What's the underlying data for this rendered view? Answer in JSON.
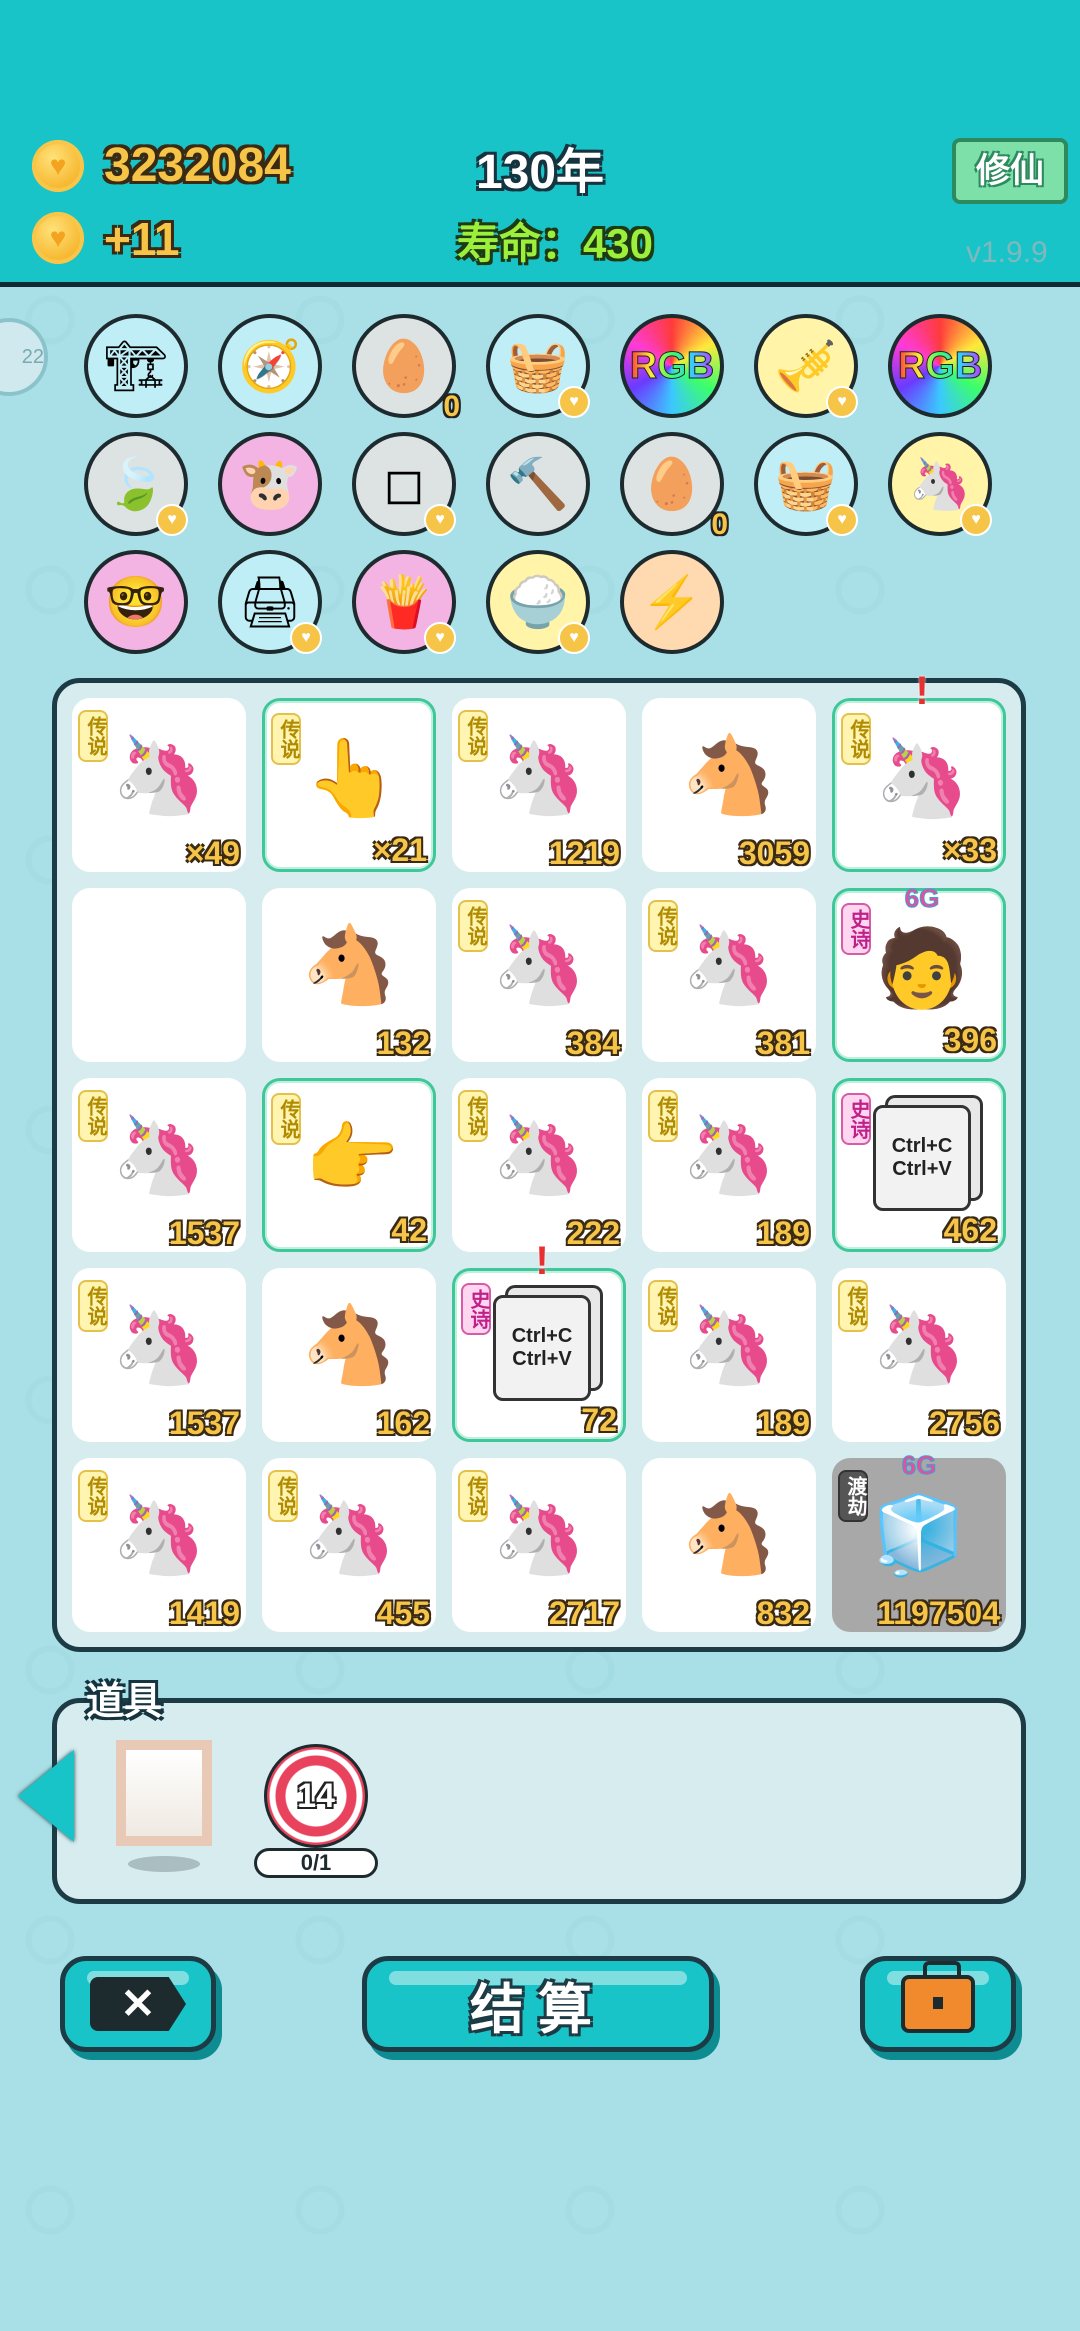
{
  "header": {
    "coins": "3232084",
    "income": "+11",
    "year": "130年",
    "lifespan": "寿命：430",
    "cultivate_button": "修仙",
    "version": "v1.9.9"
  },
  "side_badge": "22",
  "items": [
    {
      "icon": "🏗",
      "bg": "#bfeef7",
      "name": "pump-icon",
      "badge": false,
      "count": ""
    },
    {
      "icon": "🧭",
      "bg": "#bfeef7",
      "name": "compass-icon",
      "badge": false,
      "count": ""
    },
    {
      "icon": "🥚",
      "bg": "#dde3e3",
      "name": "egg-tray-icon",
      "badge": false,
      "count": "0"
    },
    {
      "icon": "🧺",
      "bg": "#bfeef7",
      "name": "fruit-basket-icon",
      "badge": true,
      "count": ""
    },
    {
      "icon": "RGB",
      "bg": "rainbow",
      "name": "rgb-icon",
      "badge": false,
      "count": ""
    },
    {
      "icon": "🎺",
      "bg": "#fff4a8",
      "name": "horn-icon",
      "badge": true,
      "count": ""
    },
    {
      "icon": "RGB",
      "bg": "rainbow",
      "name": "rgb-icon",
      "badge": false,
      "count": ""
    },
    {
      "icon": "🍃",
      "bg": "#dde3e3",
      "name": "leaf-icon",
      "badge": true,
      "count": ""
    },
    {
      "icon": "🐮",
      "bg": "#f3b3e3",
      "name": "cow-icon",
      "badge": false,
      "count": ""
    },
    {
      "icon": "◻",
      "bg": "#dde3e3",
      "name": "sugar-cube-icon",
      "badge": true,
      "count": ""
    },
    {
      "icon": "🔨",
      "bg": "#dde3e3",
      "name": "hammer-icon",
      "badge": false,
      "count": ""
    },
    {
      "icon": "🥚",
      "bg": "#dde3e3",
      "name": "egg-tray-icon",
      "badge": false,
      "count": "0"
    },
    {
      "icon": "🧺",
      "bg": "#bfeef7",
      "name": "fruit-basket-icon",
      "badge": true,
      "count": ""
    },
    {
      "icon": "🦄",
      "bg": "#fff4a8",
      "name": "unicorn-icon",
      "badge": true,
      "count": ""
    },
    {
      "icon": "🤓",
      "bg": "#f3b3e3",
      "name": "math-nerd-icon",
      "badge": false,
      "count": ""
    },
    {
      "icon": "🖨",
      "bg": "#bfeef7",
      "name": "printer-icon",
      "badge": true,
      "count": ""
    },
    {
      "icon": "🍟",
      "bg": "#f3b3e3",
      "name": "fries-icon",
      "badge": true,
      "count": ""
    },
    {
      "icon": "🍚",
      "bg": "#fff4a8",
      "name": "rice-bowl-icon",
      "badge": true,
      "count": ""
    },
    {
      "icon": "⚡",
      "bg": "#ffd9b0",
      "name": "lightning-icon",
      "badge": false,
      "count": ""
    }
  ],
  "board": [
    {
      "icon": "🦄",
      "tag": "传说",
      "tag_type": "legend",
      "num": "×49",
      "hl": false,
      "top": "",
      "excl": false
    },
    {
      "icon": "👆",
      "tag": "传说",
      "tag_type": "legend",
      "num": "×21",
      "hl": true,
      "top": "",
      "excl": false
    },
    {
      "icon": "🦄",
      "tag": "传说",
      "tag_type": "legend",
      "num": "1219",
      "hl": false,
      "top": "",
      "excl": false
    },
    {
      "icon": "🐴",
      "tag": "",
      "tag_type": "",
      "num": "3059",
      "hl": false,
      "top": "",
      "excl": false
    },
    {
      "icon": "🦄",
      "tag": "传说",
      "tag_type": "legend",
      "num": "×33",
      "hl": true,
      "top": "",
      "excl": true
    },
    {
      "icon": "",
      "tag": "",
      "tag_type": "",
      "num": "",
      "hl": false,
      "top": "",
      "excl": false
    },
    {
      "icon": "🐴",
      "tag": "",
      "tag_type": "",
      "num": "132",
      "hl": false,
      "top": "",
      "excl": false
    },
    {
      "icon": "🦄",
      "tag": "传说",
      "tag_type": "legend",
      "num": "384",
      "hl": false,
      "top": "",
      "excl": false
    },
    {
      "icon": "🦄",
      "tag": "传说",
      "tag_type": "legend",
      "num": "381",
      "hl": false,
      "top": "",
      "excl": false
    },
    {
      "icon": "🧑",
      "tag": "史诗",
      "tag_type": "epic",
      "num": "396",
      "hl": true,
      "top": "6G",
      "excl": false
    },
    {
      "icon": "🦄",
      "tag": "传说",
      "tag_type": "legend",
      "num": "1537",
      "hl": false,
      "top": "",
      "excl": false
    },
    {
      "icon": "👉",
      "tag": "传说",
      "tag_type": "legend",
      "num": "42",
      "hl": true,
      "top": "",
      "excl": false
    },
    {
      "icon": "🦄",
      "tag": "传说",
      "tag_type": "legend",
      "num": "222",
      "hl": false,
      "top": "",
      "excl": false
    },
    {
      "icon": "🦄",
      "tag": "传说",
      "tag_type": "legend",
      "num": "189",
      "hl": false,
      "top": "",
      "excl": false
    },
    {
      "icon": "📄",
      "tag": "史诗",
      "tag_type": "epic",
      "num": "462",
      "hl": true,
      "top": "",
      "excl": false
    },
    {
      "icon": "🦄",
      "tag": "传说",
      "tag_type": "legend",
      "num": "1537",
      "hl": false,
      "top": "",
      "excl": false
    },
    {
      "icon": "🐴",
      "tag": "",
      "tag_type": "",
      "num": "162",
      "hl": false,
      "top": "",
      "excl": false
    },
    {
      "icon": "📄",
      "tag": "史诗",
      "tag_type": "epic",
      "num": "72",
      "hl": true,
      "top": "",
      "excl": true
    },
    {
      "icon": "🦄",
      "tag": "传说",
      "tag_type": "legend",
      "num": "189",
      "hl": false,
      "top": "",
      "excl": false
    },
    {
      "icon": "🦄",
      "tag": "传说",
      "tag_type": "legend",
      "num": "2756",
      "hl": false,
      "top": "",
      "excl": false
    },
    {
      "icon": "🦄",
      "tag": "传说",
      "tag_type": "legend",
      "num": "1419",
      "hl": false,
      "top": "",
      "excl": false
    },
    {
      "icon": "🦄",
      "tag": "传说",
      "tag_type": "legend",
      "num": "455",
      "hl": false,
      "top": "",
      "excl": false
    },
    {
      "icon": "🦄",
      "tag": "传说",
      "tag_type": "legend",
      "num": "2717",
      "hl": false,
      "top": "",
      "excl": false
    },
    {
      "icon": "🐴",
      "tag": "",
      "tag_type": "",
      "num": "832",
      "hl": false,
      "top": "",
      "excl": false
    },
    {
      "icon": "🧊",
      "tag": "渡劫",
      "tag_type": "tribulation",
      "num": "1197504",
      "hl": false,
      "top": "6G",
      "excl": false,
      "gray": true
    }
  ],
  "copy_paste_text": [
    "Ctrl+C",
    "Ctrl+V"
  ],
  "props": {
    "label": "道具",
    "target_value": "14",
    "target_progress": "0/1"
  },
  "buttons": {
    "close_label": "✕",
    "settle_label": "结算"
  },
  "colors": {
    "accent": "#18c4c8",
    "gold": "#f6c548",
    "highlight": "#3fc79a"
  }
}
